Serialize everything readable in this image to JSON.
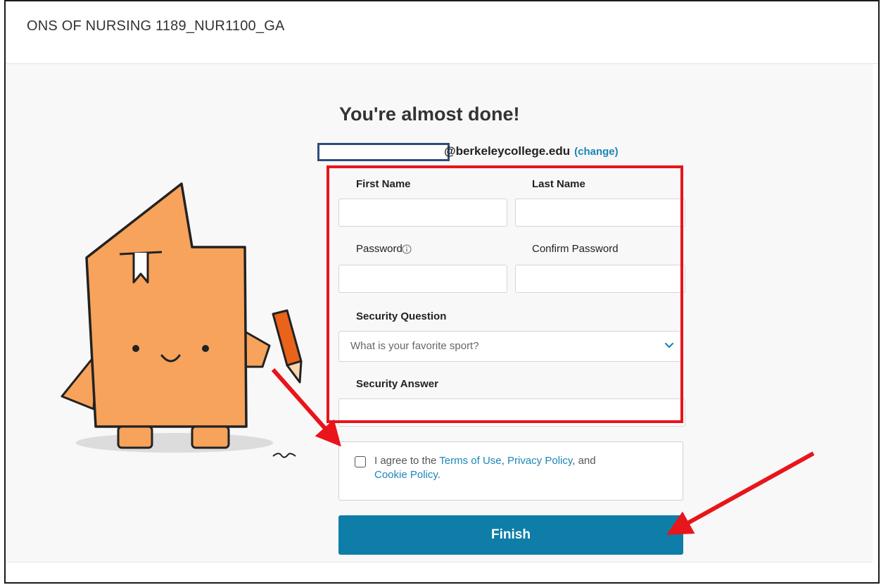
{
  "header": {
    "course_title": "ONS OF NURSING 1189_NUR1100_GA"
  },
  "form": {
    "heading": "You're almost done!",
    "email_domain": "@berkeleycollege.edu",
    "change_link": "(change)",
    "first_name_label": "First Name",
    "last_name_label": "Last Name",
    "password_label": "Password",
    "confirm_password_label": "Confirm Password",
    "security_question_label": "Security Question",
    "security_question_value": "What is your favorite sport?",
    "security_answer_label": "Security Answer",
    "terms_prefix": "I agree to the ",
    "terms_of_use": "Terms of Use",
    "terms_comma": ", ",
    "privacy_policy": "Privacy Policy",
    "terms_and": ", and",
    "cookie_policy": "Cookie Policy",
    "terms_period": ".",
    "finish_label": "Finish"
  },
  "colors": {
    "accent": "#0e7ea8",
    "link": "#1b85b8",
    "highlight": "#e8151b",
    "redact_border": "#2f4d7b",
    "mascot": "#f7a35c"
  },
  "icons": {
    "info": "info-icon",
    "chevron": "chevron-down-icon",
    "mascot": "mascot-illustration"
  }
}
